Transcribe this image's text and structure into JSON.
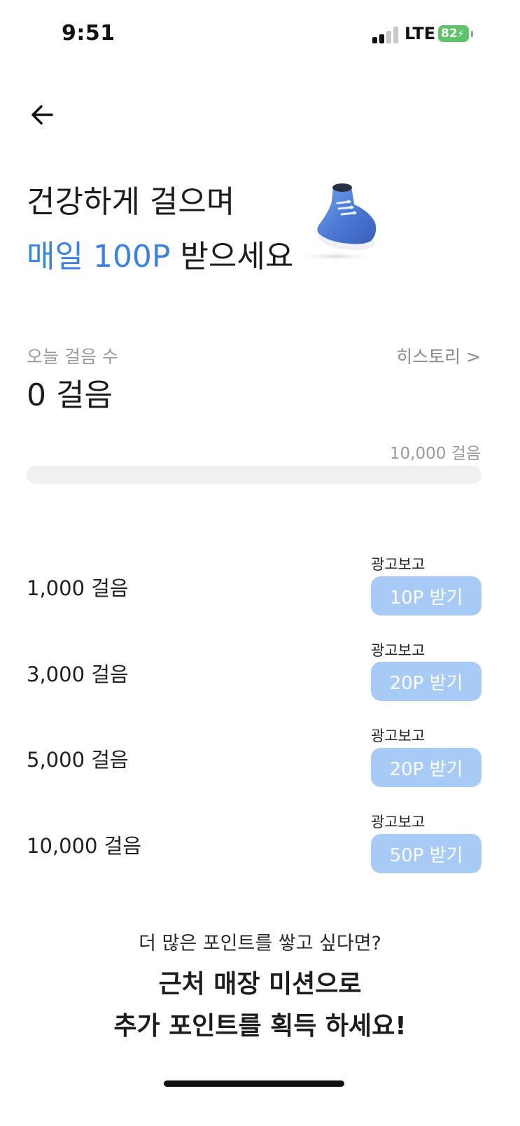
{
  "status_bar": {
    "time": "9:51",
    "network": "LTE",
    "battery": "82",
    "battery_color": "#5ec36a"
  },
  "nav": {
    "back_icon": "arrow-left-icon"
  },
  "hero": {
    "line1": "건강하게 걸으며",
    "line2_highlight": "매일 100P",
    "line2_rest": " 받으세요",
    "highlight_color": "#3b82e6",
    "illustration": "sneaker-illustration"
  },
  "steps": {
    "today_label": "오늘 걸음 수",
    "history_link": "히스토리 >",
    "count_text": "0 걸음",
    "goal_text": "10,000 걸음",
    "progress_fraction": 0
  },
  "rewards": [
    {
      "steps_label": "1,000 걸음",
      "ad_label": "광고보고",
      "button_label": "10P 받기"
    },
    {
      "steps_label": "3,000 걸음",
      "ad_label": "광고보고",
      "button_label": "20P 받기"
    },
    {
      "steps_label": "5,000 걸음",
      "ad_label": "광고보고",
      "button_label": "20P 받기"
    },
    {
      "steps_label": "10,000 걸음",
      "ad_label": "광고보고",
      "button_label": "50P 받기"
    }
  ],
  "promo": {
    "subtitle": "더 많은 포인트를 쌓고 싶다면?",
    "title_line1": "근처 매장 미션으로",
    "title_line2": "추가 포인트를 획득 하세요!"
  },
  "colors": {
    "button_disabled": "#a7cbf5",
    "progress_track": "#f1f0f0"
  }
}
